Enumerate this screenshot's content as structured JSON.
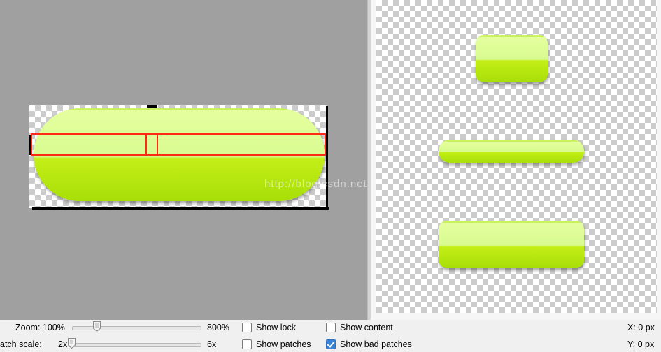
{
  "editor": {
    "watermark": "http://blog.csdn.net/"
  },
  "controls": {
    "zoom": {
      "label": "Zoom: 100%",
      "max_label": "800%",
      "value_percent": 100,
      "min_percent": 100,
      "max_percent": 800
    },
    "patch_scale": {
      "label": "atch scale:",
      "min_label": "2x",
      "max_label": "6x",
      "value": 2,
      "min": 2,
      "max": 6
    },
    "show_lock": {
      "label": "Show lock",
      "checked": false
    },
    "show_patches": {
      "label": "Show patches",
      "checked": false
    },
    "show_content": {
      "label": "Show content",
      "checked": false
    },
    "show_bad_patches": {
      "label": "Show bad patches",
      "checked": true
    },
    "x_readout": "X: 0 px",
    "y_readout": "Y: 0 px"
  },
  "colors": {
    "accent_checkbox": "#3b83d6",
    "bad_patch_outline": "#ff2a12",
    "button_top": "#e6ffa0",
    "button_bottom": "#a8de08",
    "editor_background": "#a0a0a0"
  }
}
